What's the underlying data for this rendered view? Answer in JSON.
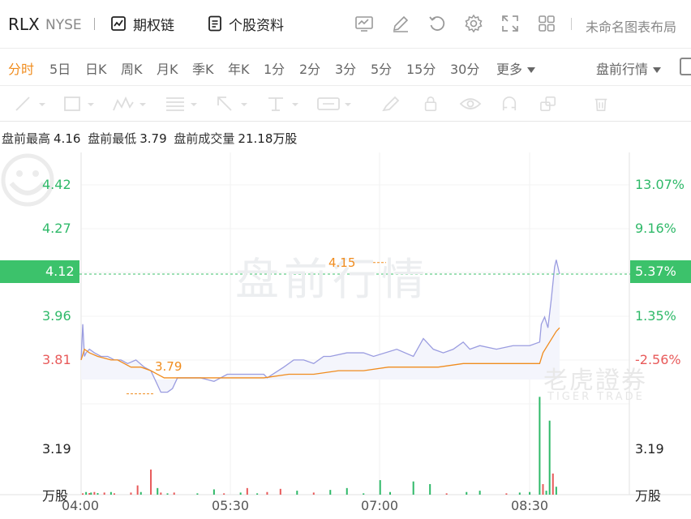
{
  "header": {
    "ticker": "RLX",
    "exchange": "NYSE",
    "options_chain": "期权链",
    "stock_profile": "个股资料",
    "layout_name": "未命名图表布局",
    "tool_icons": [
      "indicator-icon",
      "draw-edit-icon",
      "reset-icon",
      "settings-icon",
      "fullscreen-icon",
      "layout-grid-icon"
    ]
  },
  "periods": {
    "items": [
      "分时",
      "5日",
      "日K",
      "周K",
      "月K",
      "季K",
      "年K",
      "1分",
      "2分",
      "3分",
      "5分",
      "15分",
      "30分"
    ],
    "more": "更多",
    "active": "分时",
    "premarket_dropdown": "盘前行情"
  },
  "drawing_tools": [
    "trend-line-icon",
    "rectangle-icon",
    "wave-pattern-icon",
    "fibonacci-icon",
    "arrow-icon",
    "text-icon",
    "measure-icon",
    "brush-icon",
    "lock-icon",
    "eye-icon",
    "magnet-icon",
    "layers-icon",
    "trash-icon"
  ],
  "stats": {
    "high_label": "盘前最高",
    "high_value": "4.16",
    "low_label": "盘前最低",
    "low_value": "3.79",
    "volume_label": "盘前成交量",
    "volume_value": "21.18万股"
  },
  "chart": {
    "watermark": "盘前行情",
    "brand_cn": "老虎證券",
    "brand_en": "TIGER TRADE",
    "price_labels": [
      "4.42",
      "4.27",
      "4.12",
      "3.96",
      "3.81"
    ],
    "pct_labels": [
      "13.07%",
      "9.16%",
      "5.37%",
      "1.35%",
      "-2.56%"
    ],
    "volume_axis_top": "3.19",
    "volume_axis_top_right": "3.19",
    "volume_unit": "万股",
    "volume_unit_right": "万股",
    "current_price": "4.12",
    "current_pct": "5.37%",
    "high_annotation": "4.15",
    "low_annotation": "3.79",
    "colors": {
      "up": "#2fb969",
      "down": "#e85a5a",
      "price_line": "#9a9ce0",
      "avg_line": "#f08c1e",
      "tag": "#3cc26b"
    }
  },
  "chart_data": {
    "type": "line",
    "x_labels": [
      "04:00",
      "05:30",
      "07:00",
      "08:30"
    ],
    "y_labels": [
      "4.42",
      "4.27",
      "4.12",
      "3.96",
      "3.81"
    ],
    "y_right_labels": [
      "13.07%",
      "9.16%",
      "5.37%",
      "1.35%",
      "-2.56%"
    ],
    "ylim": [
      3.78,
      4.46
    ],
    "x_range_minutes": [
      0,
      330
    ],
    "series": [
      {
        "x": [
          0,
          1,
          2,
          3,
          5,
          8,
          12,
          16,
          20,
          24,
          28,
          33,
          38,
          42,
          45,
          48,
          52,
          55,
          58,
          61,
          66,
          72,
          80,
          88,
          95,
          100,
          110,
          112,
          122,
          128,
          134,
          140,
          146,
          150,
          160,
          170,
          176,
          190,
          200,
          206,
          212,
          218,
          224,
          230,
          234,
          240,
          250,
          260,
          270,
          276,
          277,
          279,
          281,
          283,
          285,
          286,
          288
        ],
        "y": [
          3.88,
          3.98,
          3.89,
          3.9,
          3.91,
          3.9,
          3.89,
          3.89,
          3.88,
          3.88,
          3.87,
          3.88,
          3.86,
          3.85,
          3.82,
          3.79,
          3.79,
          3.8,
          3.83,
          3.83,
          3.83,
          3.83,
          3.82,
          3.84,
          3.84,
          3.84,
          3.84,
          3.83,
          3.86,
          3.88,
          3.88,
          3.87,
          3.89,
          3.89,
          3.9,
          3.9,
          3.89,
          3.91,
          3.89,
          3.94,
          3.91,
          3.9,
          3.91,
          3.93,
          3.91,
          3.92,
          3.91,
          3.92,
          3.92,
          3.93,
          3.98,
          4.0,
          3.97,
          4.05,
          4.14,
          4.16,
          4.12
        ]
      },
      {
        "x": [
          0,
          2,
          5,
          10,
          18,
          22,
          26,
          30,
          36,
          42,
          46,
          50,
          55,
          60,
          68,
          80,
          95,
          110,
          125,
          140,
          155,
          170,
          185,
          200,
          215,
          230,
          245,
          260,
          276,
          278,
          282,
          286,
          288
        ],
        "y": [
          3.88,
          3.91,
          3.9,
          3.89,
          3.88,
          3.88,
          3.87,
          3.86,
          3.86,
          3.85,
          3.84,
          3.83,
          3.83,
          3.83,
          3.83,
          3.83,
          3.83,
          3.83,
          3.84,
          3.84,
          3.85,
          3.85,
          3.86,
          3.86,
          3.86,
          3.87,
          3.87,
          3.87,
          3.87,
          3.9,
          3.93,
          3.96,
          3.97
        ]
      }
    ],
    "volume": {
      "x": [
        1,
        3,
        5,
        6,
        8,
        10,
        14,
        18,
        20,
        30,
        34,
        36,
        42,
        46,
        48,
        52,
        56,
        70,
        80,
        86,
        96,
        100,
        106,
        112,
        120,
        130,
        140,
        150,
        160,
        170,
        180,
        186,
        200,
        210,
        220,
        232,
        240,
        256,
        264,
        270,
        276,
        278,
        280,
        282,
        284,
        286
      ],
      "v": [
        0.05,
        0.1,
        0.06,
        0.08,
        0.1,
        0.06,
        0.08,
        0.1,
        0.05,
        0.08,
        0.35,
        0.1,
        0.95,
        0.25,
        0.08,
        0.05,
        0.08,
        0.05,
        0.2,
        0.05,
        0.08,
        0.25,
        0.05,
        0.1,
        0.22,
        0.15,
        0.08,
        0.18,
        0.25,
        0.05,
        0.55,
        0.1,
        0.5,
        0.4,
        0.05,
        0.1,
        0.15,
        0.05,
        0.08,
        0.1,
        3.7,
        0.4,
        0.15,
        2.8,
        0.8,
        0.3
      ],
      "up": [
        false,
        true,
        false,
        true,
        false,
        true,
        false,
        true,
        false,
        false,
        false,
        true,
        false,
        true,
        false,
        true,
        false,
        true,
        true,
        false,
        true,
        false,
        true,
        false,
        false,
        true,
        false,
        true,
        true,
        true,
        true,
        true,
        true,
        true,
        false,
        true,
        true,
        false,
        true,
        true,
        true,
        false,
        true,
        true,
        false,
        true
      ],
      "ylim": [
        0,
        3.19
      ]
    }
  }
}
